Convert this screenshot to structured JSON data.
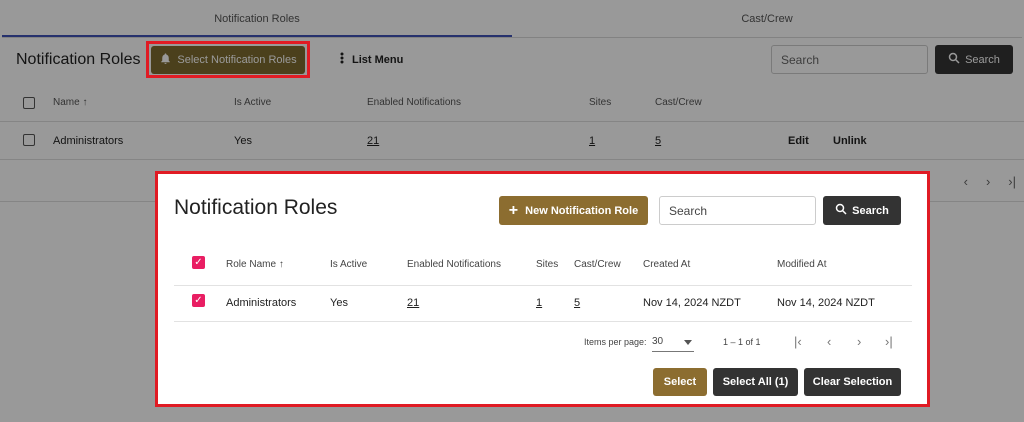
{
  "background": {
    "tabs": [
      "Notification Roles",
      "Cast/Crew"
    ],
    "title": "Notification Roles",
    "select_button": "Select Notification Roles",
    "list_menu": "List Menu",
    "search_placeholder": "Search",
    "search_button": "Search",
    "columns": [
      "Name",
      "Is Active",
      "Enabled Notifications",
      "Sites",
      "Cast/Crew"
    ],
    "row": {
      "name": "Administrators",
      "is_active": "Yes",
      "enabled_notifications": "21",
      "sites": "1",
      "cast_crew": "5",
      "edit": "Edit",
      "unlink": "Unlink"
    },
    "sort_icon": "arrow-up-icon"
  },
  "modal": {
    "title": "Notification Roles",
    "new_role_button": "New Notification Role",
    "search_placeholder": "Search",
    "search_button": "Search",
    "columns": [
      "Role Name",
      "Is Active",
      "Enabled Notifications",
      "Sites",
      "Cast/Crew",
      "Created At",
      "Modified At"
    ],
    "row": {
      "name": "Administrators",
      "is_active": "Yes",
      "enabled_notifications": "21",
      "sites": "1",
      "cast_crew": "5",
      "created_at": "Nov 14, 2024 NZDT",
      "modified_at": "Nov 14, 2024 NZDT"
    },
    "paginator": {
      "items_per_page_label": "Items per page:",
      "items_per_page": "30",
      "range": "1 – 1 of 1"
    },
    "actions": {
      "select": "Select",
      "select_all": "Select All (1)",
      "clear_selection": "Clear Selection"
    }
  },
  "colors": {
    "accent_gold": "#8c6d30",
    "dark_button": "#333333",
    "highlight_red": "#e01b24",
    "checkbox_pink": "#e91e63"
  }
}
